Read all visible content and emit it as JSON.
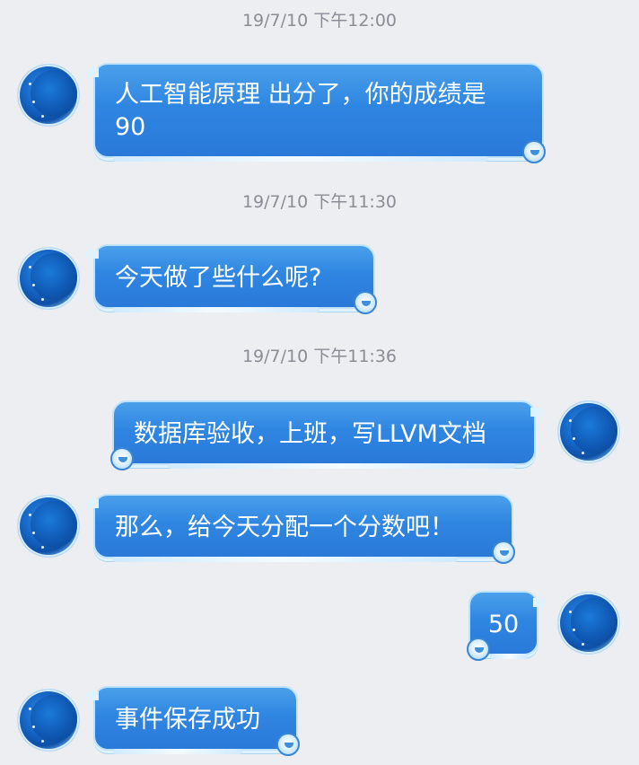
{
  "chat": {
    "timestamps": [
      "19/7/10 下午12:00",
      "19/7/10 下午11:30",
      "19/7/10 下午11:36"
    ],
    "messages": [
      {
        "side": "left",
        "text": "人工智能原理 出分了，你的成绩是 90"
      },
      {
        "side": "left",
        "text": "今天做了些什么呢?"
      },
      {
        "side": "right",
        "text": "数据库验收，上班，写LLVM文档"
      },
      {
        "side": "left",
        "text": "那么，给今天分配一个分数吧！"
      },
      {
        "side": "right",
        "text": "50"
      },
      {
        "side": "left",
        "text": "事件保存成功"
      }
    ]
  },
  "colors": {
    "background": "#edeef2",
    "bubble": "#2f86e1",
    "timestamp": "#8a8d95"
  },
  "icons": {
    "avatar": "moon-avatar-icon",
    "bubble_decoration": "mascot-icon"
  }
}
